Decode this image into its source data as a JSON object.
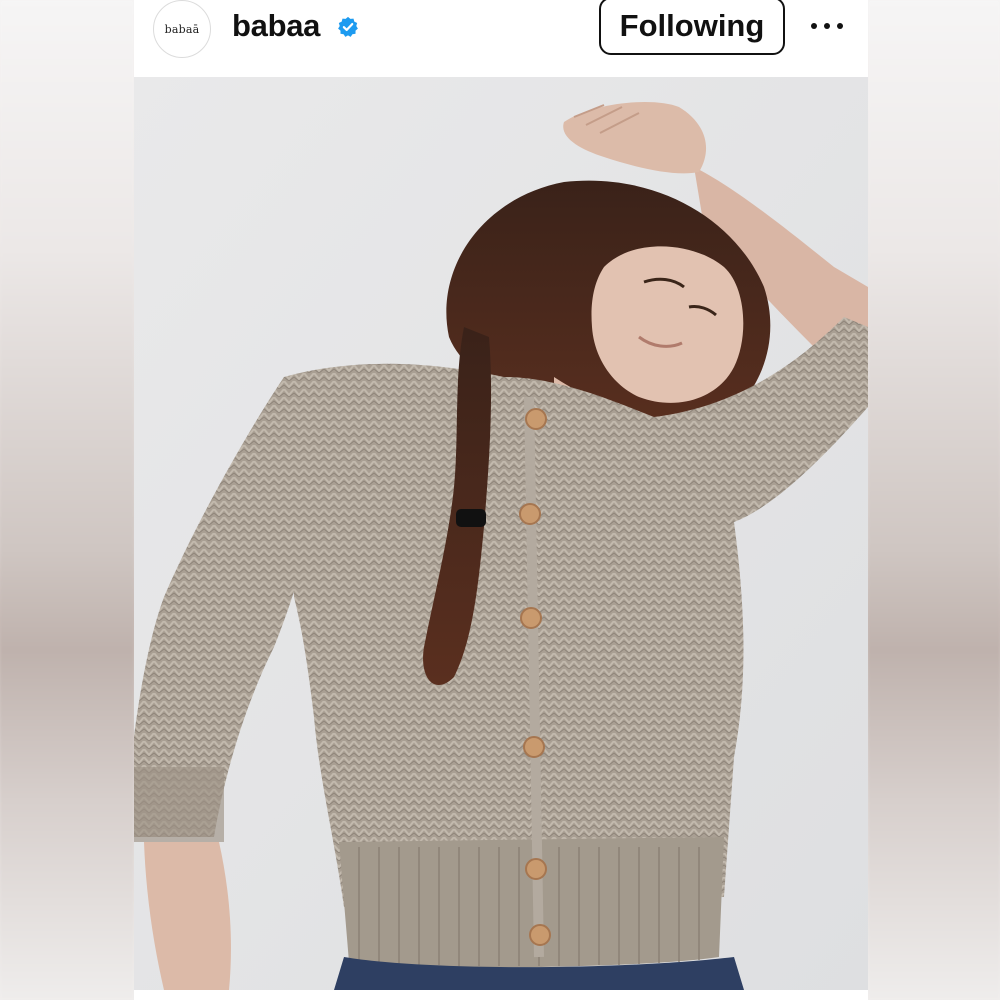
{
  "account": {
    "avatar_text": "babaā",
    "username": "babaa",
    "verified": true,
    "follow_label": "Following"
  },
  "icons": {
    "verified": "verified-badge-icon",
    "more": "more-options-icon"
  },
  "photo": {
    "subject": "model-in-knit-cardigan"
  },
  "colors": {
    "verified_blue": "#1d9bf0",
    "text": "#111111"
  }
}
